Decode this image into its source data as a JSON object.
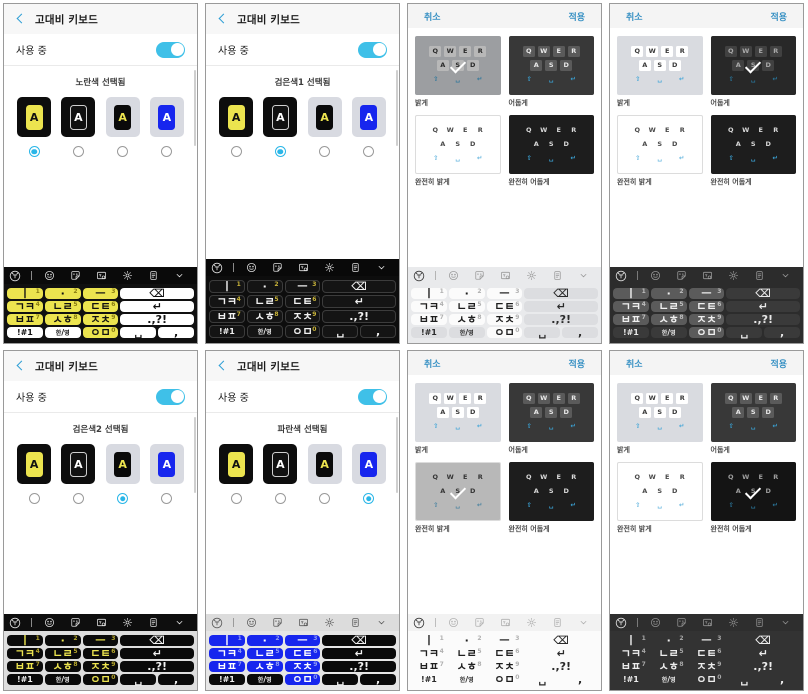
{
  "settings": {
    "title": "고대비 키보드",
    "using_label": "사용 중",
    "toggle_state": "on",
    "back_icon": "back-chevron-icon",
    "swatch_labels": [
      "A",
      "A",
      "A",
      "A"
    ]
  },
  "theme_chooser": {
    "cancel_label": "취소",
    "apply_label": "적용",
    "options": [
      {
        "label": "밝게",
        "variant": "th-light"
      },
      {
        "label": "어둡게",
        "variant": "th-dark"
      },
      {
        "label": "완전히 밝게",
        "variant": "th-flight"
      },
      {
        "label": "완전히 어둡게",
        "variant": "th-fdark"
      }
    ],
    "thumb_keys_row1": [
      "Q",
      "W",
      "E",
      "R"
    ],
    "thumb_keys_row2": [
      "A",
      "S",
      "D"
    ],
    "thumb_keys_row3": [
      "⇧",
      "␣",
      "↵"
    ]
  },
  "keyboard": {
    "toolbar_icons": [
      "samsung-keyboard-icon",
      "toolbar-divider",
      "emoji-icon",
      "sticker-icon",
      "gif-icon",
      "gear-icon",
      "clipboard-icon",
      "chevron-down-icon"
    ],
    "keys": [
      {
        "label": "ㅣ",
        "num": "1",
        "fn": false
      },
      {
        "label": "·",
        "num": "2",
        "fn": false
      },
      {
        "label": "ㅡ",
        "num": "3",
        "fn": false
      },
      {
        "label": "⌫",
        "num": "",
        "fn": true,
        "span": 2
      },
      {
        "label": "ㄱㅋ",
        "num": "4",
        "fn": false
      },
      {
        "label": "ㄴㄹ",
        "num": "5",
        "fn": false
      },
      {
        "label": "ㄷㅌ",
        "num": "6",
        "fn": false
      },
      {
        "label": "↵",
        "num": "",
        "fn": true,
        "span": 2
      },
      {
        "label": "ㅂㅍ",
        "num": "7",
        "fn": false
      },
      {
        "label": "ㅅㅎ",
        "num": "8",
        "fn": false
      },
      {
        "label": "ㅈㅊ",
        "num": "9",
        "fn": false
      },
      {
        "label": ".,?!",
        "num": "",
        "fn": true,
        "span": 2
      },
      {
        "label": "!#1",
        "num": "",
        "fn": true,
        "small": true
      },
      {
        "label": "한/영",
        "num": "",
        "fn": true,
        "small": true
      },
      {
        "label": "ㅇㅁ",
        "num": "0",
        "fn": false
      },
      {
        "label": "␣",
        "num": "",
        "fn": true
      },
      {
        "label": ",",
        "num": "",
        "fn": true
      }
    ]
  },
  "panels": [
    {
      "id": "panel-1",
      "kind": "settings",
      "caption": "노란색 선택됨",
      "selected_index": 0,
      "keyboard_theme": "kb-yellow"
    },
    {
      "id": "panel-2",
      "kind": "settings",
      "caption": "검은색1 선택됨",
      "selected_index": 1,
      "keyboard_theme": "kb-black"
    },
    {
      "id": "panel-3",
      "kind": "theme",
      "selected_index": 0,
      "keyboard_theme": "kb-slight"
    },
    {
      "id": "panel-4",
      "kind": "theme",
      "selected_index": 1,
      "keyboard_theme": "kb-sdark"
    },
    {
      "id": "panel-5",
      "kind": "settings",
      "caption": "검은색2 선택됨",
      "selected_index": 2,
      "keyboard_theme": "kb-blacky"
    },
    {
      "id": "panel-6",
      "kind": "settings",
      "caption": "파란색 선택됨",
      "selected_index": 3,
      "keyboard_theme": "kb-blue"
    },
    {
      "id": "panel-7",
      "kind": "theme",
      "selected_index": 2,
      "keyboard_theme": "kb-flight"
    },
    {
      "id": "panel-8",
      "kind": "theme",
      "selected_index": 3,
      "keyboard_theme": "kb-fdark"
    }
  ],
  "colors": {
    "accent_blue": "#29b6e8",
    "link_blue": "#3a92c4",
    "key_yellow": "#ece44f",
    "key_blue": "#1726ee"
  }
}
